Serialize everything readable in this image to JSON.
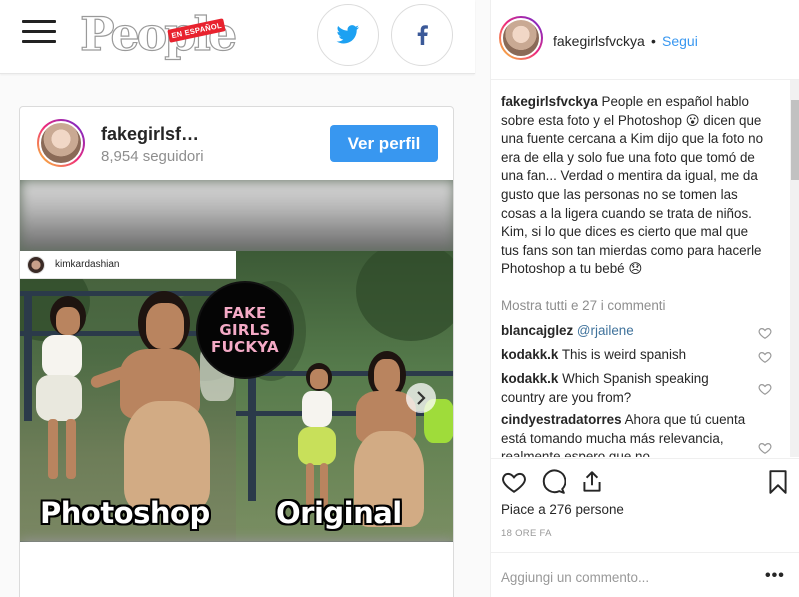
{
  "site": {
    "logo_text": "People",
    "logo_badge": "EN ESPAÑOL"
  },
  "share": {
    "twitter_icon": "twitter-bird-icon",
    "facebook_icon": "facebook-f-icon"
  },
  "embed": {
    "username": "fakegirlsf…",
    "followers": "8,954 seguidori",
    "view_profile_label": "Ver perfil",
    "inner_username": "kimkardashian",
    "watermark_line1": "FAKE GIRLS",
    "watermark_line2": "FUCKYA",
    "label_left": "Photoshop",
    "label_right": "Original"
  },
  "post": {
    "username": "fakegirlsfvckya",
    "dot": "•",
    "follow_label": "Segui",
    "caption_user": "fakegirlsfvckya",
    "caption_p1": "People en español hablo sobre esta foto y el Photoshop 😮 dicen que una fuente cercana a Kim dijo que la foto no era de ella y solo fue una foto que tomó de una fan... Verdad o mentira da igual, me da gusto que las personas no se tomen las cosas a la ligera cuando se trata de niños.",
    "caption_p2": "Kim, si lo que dices es cierto que mal que tus fans son tan mierdas como para hacerle Photoshop a tu bebé 😞",
    "show_all_label": "Mostra tutti e 27 i commenti",
    "comments": [
      {
        "user": "blancajglez",
        "text": "@rjailene"
      },
      {
        "user": "kodakk.k",
        "text": "This is weird spanish"
      },
      {
        "user": "kodakk.k",
        "text": "Which Spanish speaking country are you from?"
      },
      {
        "user": "cindyestradatorres",
        "text": "Ahora que tú cuenta está tomando mucha más relevancia, realmente espero que no"
      }
    ],
    "likes_text": "Piace a 276 persone",
    "timestamp": "18 ORE FA",
    "comment_placeholder": "Aggiungi un commento...",
    "more_label": "•••"
  },
  "colors": {
    "accent_blue": "#3897f0",
    "follow_blue": "#3897f0",
    "watermark_pink": "#f4aac6",
    "people_red": "#e8222e"
  }
}
